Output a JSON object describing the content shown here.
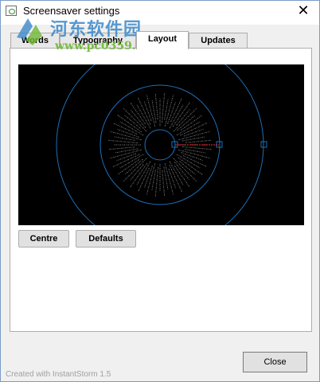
{
  "window": {
    "title": "Screensaver settings",
    "close_glyph": "✕"
  },
  "watermark": {
    "brand": "河东软件园",
    "url": "www.pc0359.cn",
    "colors": {
      "blue": "#3b88c9",
      "green": "#6fb833"
    }
  },
  "tabs": [
    {
      "label": "Words",
      "active": false
    },
    {
      "label": "Typography",
      "active": false
    },
    {
      "label": "Layout",
      "active": true
    },
    {
      "label": "Updates",
      "active": false
    }
  ],
  "preview": {
    "background": "#000000",
    "ring_color": "#1e6fb5",
    "word_color": "#8a8a8a",
    "highlight_color": "#cc2222"
  },
  "buttons": {
    "centre": "Centre",
    "defaults": "Defaults",
    "close": "Close"
  },
  "footer": "Created with InstantStorm 1.5"
}
